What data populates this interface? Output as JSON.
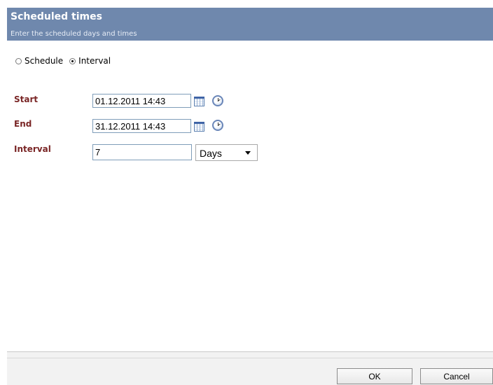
{
  "header": {
    "title": "Scheduled times",
    "subtitle": "Enter the scheduled days and times"
  },
  "mode": {
    "options": [
      {
        "label": "Schedule",
        "checked": false
      },
      {
        "label": "Interval",
        "checked": true
      }
    ]
  },
  "fields": {
    "start": {
      "label": "Start",
      "value": "01.12.2011 14:43"
    },
    "end": {
      "label": "End",
      "value": "31.12.2011 14:43"
    },
    "interval": {
      "label": "Interval",
      "value": "7",
      "unit": "Days"
    }
  },
  "icons": {
    "calendar": "calendar-icon",
    "clock": "clock-icon"
  },
  "buttons": {
    "ok": "OK",
    "cancel": "Cancel"
  },
  "colors": {
    "header_bg": "#6f88ad",
    "label": "#7a2626"
  }
}
